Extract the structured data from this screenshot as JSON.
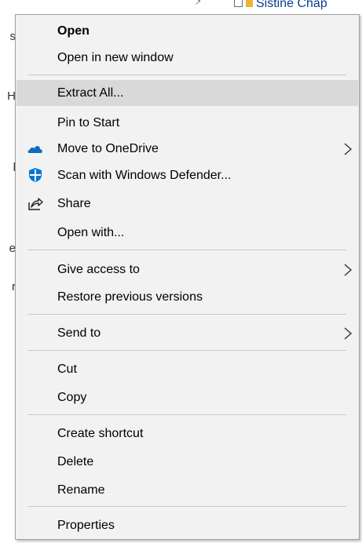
{
  "background": {
    "window_title": "Sistine Chap",
    "left_fragments": [
      "s",
      "H",
      "l",
      "e",
      "r"
    ]
  },
  "menu": {
    "items": [
      {
        "label": "Open",
        "bold": true
      },
      {
        "label": "Open in new window"
      },
      {
        "label": "Extract All..."
      },
      {
        "label": "Pin to Start"
      },
      {
        "label": "Move to OneDrive",
        "icon": "onedrive-icon",
        "submenu": true
      },
      {
        "label": "Scan with Windows Defender...",
        "icon": "windows-defender-icon"
      },
      {
        "label": "Share",
        "icon": "share-icon"
      },
      {
        "label": "Open with..."
      },
      {
        "label": "Give access to",
        "submenu": true
      },
      {
        "label": "Restore previous versions"
      },
      {
        "label": "Send to",
        "submenu": true
      },
      {
        "label": "Cut"
      },
      {
        "label": "Copy"
      },
      {
        "label": "Create shortcut"
      },
      {
        "label": "Delete"
      },
      {
        "label": "Rename"
      },
      {
        "label": "Properties"
      }
    ],
    "highlighted_item": "Extract All...",
    "colors": {
      "menu_background": "#f2f2f2",
      "highlight": "#d9d9d9",
      "separator": "#c8c8c8",
      "onedrive_blue": "#0f6cbd",
      "defender_blue": "#0078d4"
    }
  }
}
